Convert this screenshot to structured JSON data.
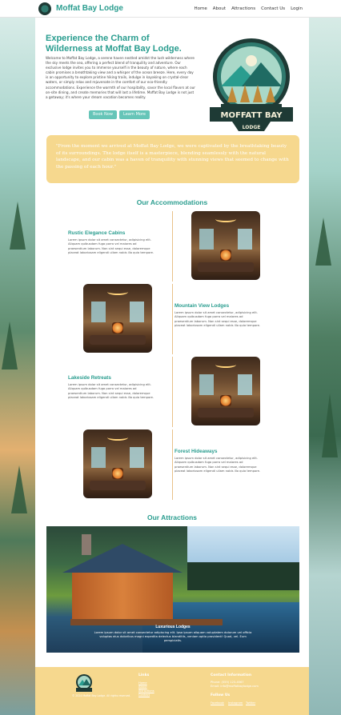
{
  "nav": {
    "brand": "Moffat Bay Lodge",
    "links": [
      "Home",
      "About",
      "Attractions",
      "Contact Us",
      "Login"
    ]
  },
  "hero": {
    "title": "Experience the Charm of Wilderness at Moffat Bay Lodge.",
    "text": "Welcome to Moffat Bay Lodge, a serene haven nestled amidst the lush wilderness where the sky meets the sea, offering a perfect blend of tranquility and adventure. Our exclusive lodge invites you to immerse yourself in the beauty of nature, where each cabin promises a breathtaking view and a whisper of the ocean breeze. Here, every day is an opportunity to explore pristine hiking trails, indulge in kayaking on crystal-clear waters, or simply relax and rejuvenate in the comfort of our eco-friendly accommodations. Experience the warmth of our hospitality, savor the local flavors at our on-site dining, and create memories that will last a lifetime. Moffat Bay Lodge is not just a getaway; it's where your dream vacation becomes reality.",
    "book_label": "Book Now",
    "learn_label": "Learn More",
    "crest_text": "MOFFATT BAY",
    "crest_subtext": "LODGE"
  },
  "testimonial": {
    "quote": "\"From the moment we arrived at Moffat Bay Lodge, we were captivated by the breathtaking beauty of its surroundings. The lodge itself is a masterpiece, blending seamlessly with the natural landscape, and our cabin was a haven of tranquility with stunning views that seemed to change with the passing of each hour.\""
  },
  "accommodations": {
    "heading": "Our Accommodations",
    "items": [
      {
        "title": "Rustic Elegance Cabins",
        "text": "Lorem ipsum dolor sit amet consectetur, adipisicing elit. Aliquam quibusdam fuga porro vel maiores ad praesentium laborum. Non sint sequi esse, doloremque placeat laboriosam eligendi ullam nobis illo quia tempore."
      },
      {
        "title": "Mountain View Lodges",
        "text": "Lorem ipsum dolor sit amet consectetur, adipisicing elit. Aliquam quibusdam fuga porro vel maiores ad praesentium laborum. Non sint sequi esse, doloremque placeat laboriosam eligendi ullam nobis illo quia tempore."
      },
      {
        "title": "Lakeside Retreats",
        "text": "Lorem ipsum dolor sit amet consectetur, adipisicing elit. Aliquam quibusdam fuga porro vel maiores ad praesentium laborum. Non sint sequi esse, doloremque placeat laboriosam eligendi ullam nobis illo quia tempore."
      },
      {
        "title": "Forest Hideaways",
        "text": "Lorem ipsum dolor sit amet consectetur, adipisicing elit. Aliquam quibusdam fuga porro vel maiores ad praesentium laborum. Non sint sequi esse, doloremque placeat laboriosam eligendi ullam nobis illo quia tempore."
      }
    ]
  },
  "attractions": {
    "heading": "Our Attractions",
    "caption_title": "Luxurious Lodges",
    "caption_text": "Lorem ipsum dolor sit amet consectetur adipiscing elit. Ipsa ipsum aliquam voluptatem dolorum vel officia voluptas eius doloribus magni expedita delectus blanditiis, veniam optio provident! Quod, vel. Eum perspiciatis."
  },
  "footer": {
    "copyright": "© 2024 Moffat Bay Lodge. All rights reserved.",
    "links_heading": "Links",
    "links": [
      "Home",
      "About",
      "Attractions",
      "Contact"
    ],
    "contact_heading": "Contact Information",
    "phone": "Phone: (555) 123-4567",
    "email": "Email: info@moffatbaylodge.com",
    "follow_heading": "Follow Us",
    "social": [
      "Facebook",
      "Instagram",
      "Twitter"
    ]
  },
  "colors": {
    "accent": "#2a9d8f",
    "button": "#66c5b8",
    "sand": "#f6d88e"
  }
}
